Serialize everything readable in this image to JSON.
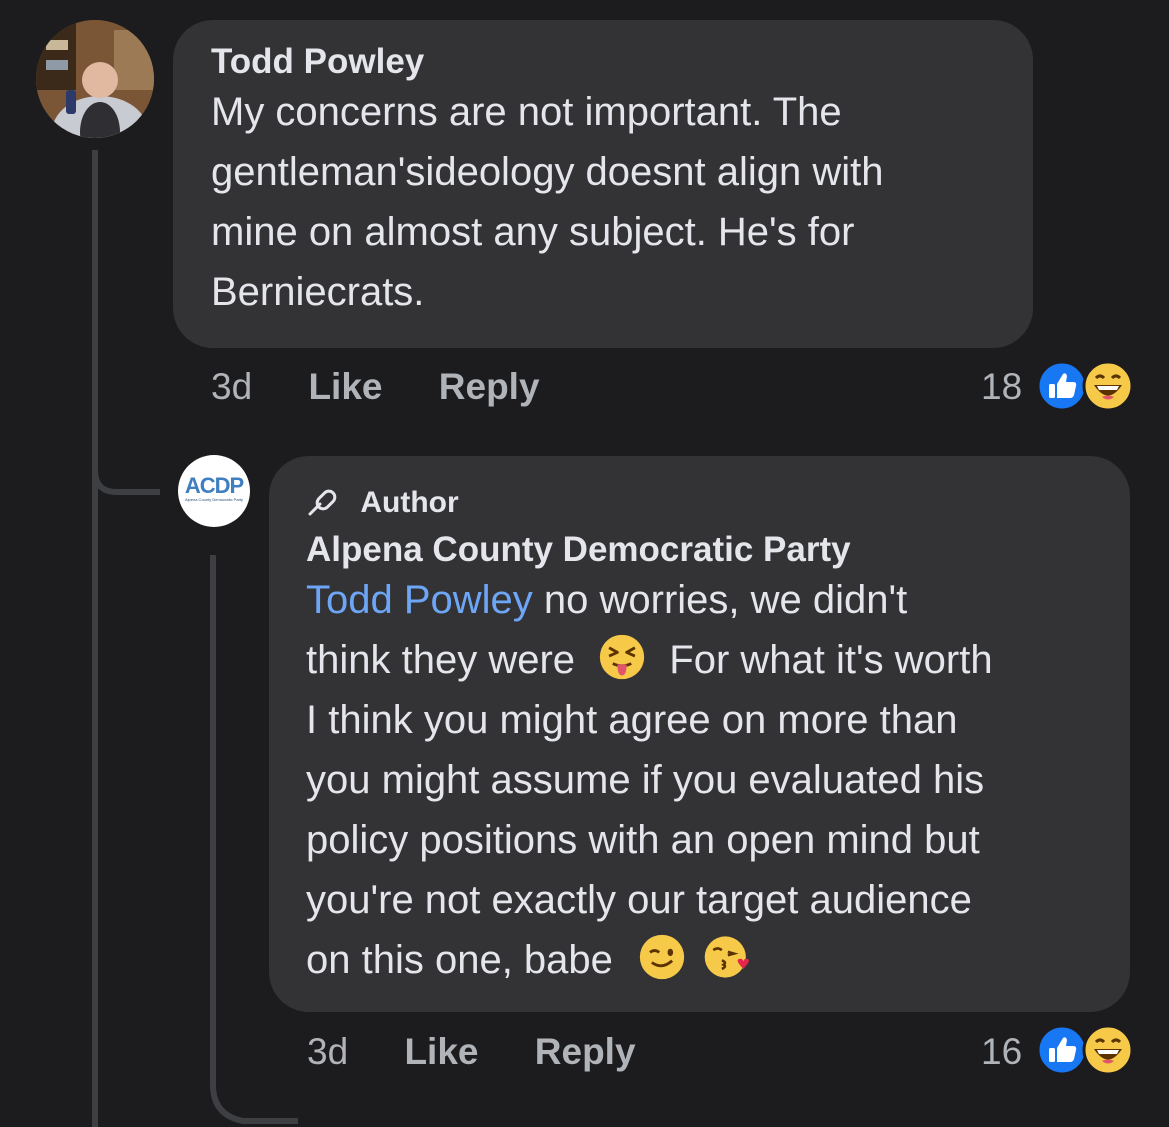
{
  "comment": {
    "author": "Todd Powley",
    "body_lines": [
      "My concerns are not important.  The",
      "gentleman'sideology doesnt align with",
      "mine on almost any subject.  He's for",
      "Berniecrats."
    ],
    "time": "3d",
    "like_label": "Like",
    "reply_label": "Reply",
    "reaction_count": "18",
    "reactions": [
      "like-icon",
      "laughing-face-icon"
    ]
  },
  "reply": {
    "badge_label": "Author",
    "author": "Alpena County Democratic Party",
    "avatar_text": "ACDP",
    "avatar_subtext": "Alpena County Democratic Party",
    "mention": "Todd Powley",
    "line1_rest": " no worries, we didn't",
    "line2_text": "think they were",
    "line2_emoji": "squinting-tongue-face-icon",
    "line2_rest": "For what it's worth",
    "body_lines": [
      "I think you might agree on more than",
      "you might assume if you evaluated his",
      "policy positions with an open mind but",
      "you're not exactly our target audience"
    ],
    "last_line_text": "on this one, babe",
    "last_line_emojis": [
      "winking-face-icon",
      "face-blowing-kiss-icon"
    ],
    "time": "3d",
    "like_label": "Like",
    "reply_label": "Reply",
    "reaction_count": "16",
    "reactions": [
      "like-icon",
      "laughing-face-icon"
    ]
  },
  "colors": {
    "background": "#1c1c1e",
    "bubble": "#333335",
    "mention": "#6ea6f7",
    "like_blue": "#1877f2",
    "emoji_yellow": "#f7c948"
  }
}
